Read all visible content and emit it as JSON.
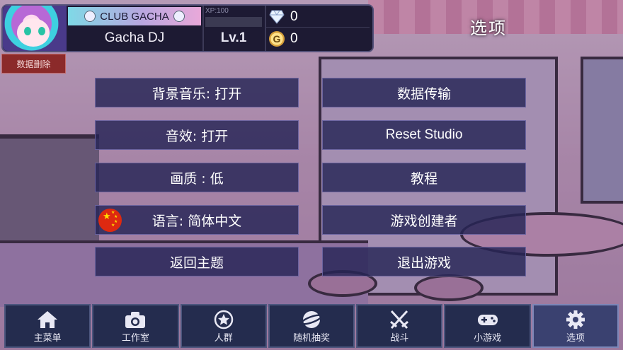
{
  "header": {
    "club_name": "CLUB GACHA",
    "player_name": "Gacha DJ",
    "xp_label": "XP:100",
    "xp_progress": 0,
    "level": "Lv.1",
    "gems": "0",
    "gold": "0",
    "gold_symbol": "G"
  },
  "delete_data_label": "数据删除",
  "page_title": "选项",
  "options": {
    "bgm": "背景音乐: 打开",
    "sfx": "音效: 打开",
    "quality": "画质 : 低",
    "language": "语言: 简体中文",
    "return_title": "返回主题",
    "data_transfer": "数据传输",
    "reset_studio": "Reset Studio",
    "tutorial": "教程",
    "game_creator": "游戏创建者",
    "exit_game": "退出游戏"
  },
  "nav": [
    {
      "label": "主菜单",
      "icon": "home-icon"
    },
    {
      "label": "工作室",
      "icon": "camera-icon"
    },
    {
      "label": "人群",
      "icon": "star-icon"
    },
    {
      "label": "随机抽奖",
      "icon": "gacha-orb-icon"
    },
    {
      "label": "战斗",
      "icon": "crossed-swords-icon"
    },
    {
      "label": "小游戏",
      "icon": "gamepad-icon"
    },
    {
      "label": "选项",
      "icon": "gear-icon"
    }
  ],
  "colors": {
    "panel": "#1d1a33",
    "button": "#262456",
    "nav": "#242c4e",
    "delete": "#8b2a2a"
  }
}
